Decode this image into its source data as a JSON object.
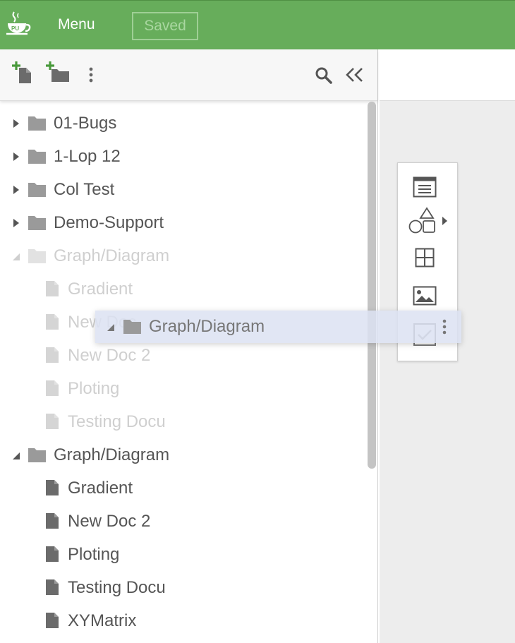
{
  "header": {
    "menu_label": "Menu",
    "saved_label": "Saved",
    "logo_icon": "coffee-cup-logo-icon",
    "background_color": "#67ad5b"
  },
  "toolbar": {
    "new_doc_icon": "add-document-icon",
    "new_folder_icon": "add-folder-icon",
    "more_icon": "vertical-ellipsis-icon",
    "search_icon": "search-icon",
    "collapse_icon": "double-chevron-left-icon"
  },
  "tree": {
    "items": [
      {
        "type": "folder",
        "label": "01-Bugs",
        "state": "collapsed"
      },
      {
        "type": "folder",
        "label": "1-Lop 12",
        "state": "collapsed"
      },
      {
        "type": "folder",
        "label": "Col Test",
        "state": "collapsed"
      },
      {
        "type": "folder",
        "label": "Demo-Support",
        "state": "collapsed"
      },
      {
        "type": "folder",
        "label": "Graph/Diagram",
        "state": "expanded",
        "ghost": true
      },
      {
        "type": "doc",
        "label": "Gradient",
        "ghost": true
      },
      {
        "type": "doc",
        "label": "New Doc",
        "ghost": true
      },
      {
        "type": "doc",
        "label": "New Doc 2",
        "ghost": true
      },
      {
        "type": "doc",
        "label": "Ploting",
        "ghost": true
      },
      {
        "type": "doc",
        "label": "Testing Docu",
        "ghost": true
      },
      {
        "type": "folder",
        "label": "Graph/Diagram",
        "state": "expanded"
      },
      {
        "type": "doc",
        "label": "Gradient"
      },
      {
        "type": "doc",
        "label": "New Doc 2"
      },
      {
        "type": "doc",
        "label": "Ploting"
      },
      {
        "type": "doc",
        "label": "Testing Docu"
      },
      {
        "type": "doc",
        "label": "XYMatrix"
      }
    ]
  },
  "drag": {
    "label": "Graph/Diagram"
  },
  "widgets": {
    "items": [
      "text-panel-icon",
      "shapes-icon",
      "table-grid-icon",
      "image-icon",
      "checkbox-icon"
    ]
  }
}
